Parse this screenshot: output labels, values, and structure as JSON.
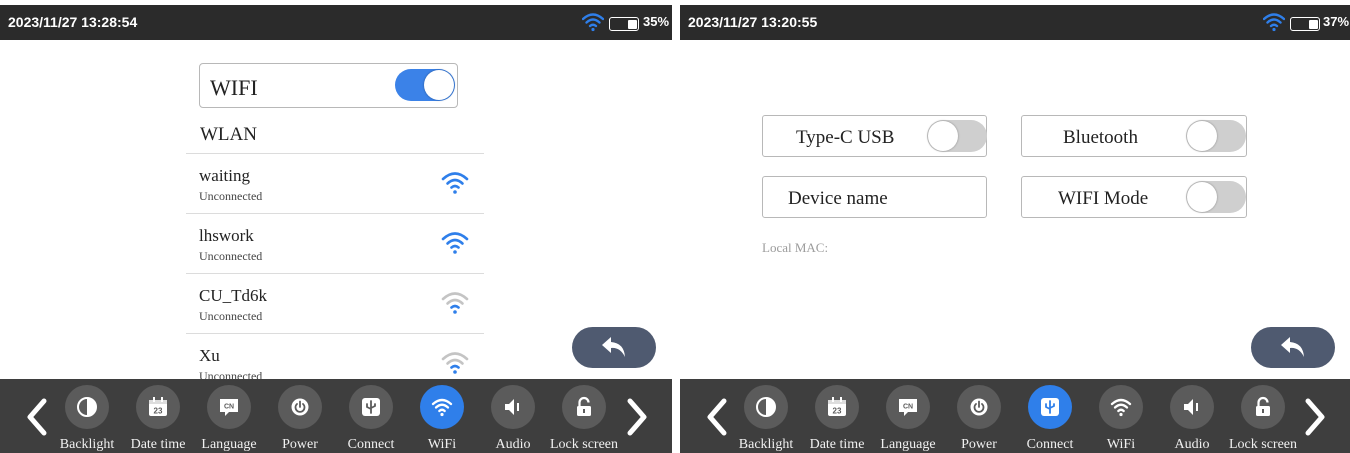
{
  "left": {
    "statusbar": {
      "datetime": "2023/11/27 13:28:54",
      "battery": "35%",
      "battery_level": 0.35
    },
    "wifi_toggle": {
      "label": "WIFI",
      "on": true
    },
    "wlan_header": "WLAN",
    "networks": [
      {
        "ssid": "waiting",
        "status": "Unconnected",
        "signal": "strong"
      },
      {
        "ssid": "lhswork",
        "status": "Unconnected",
        "signal": "strong"
      },
      {
        "ssid": "CU_Td6k",
        "status": "Unconnected",
        "signal": "weak"
      },
      {
        "ssid": "Xu",
        "status": "Unconnected",
        "signal": "weak"
      }
    ],
    "active_tab": "WiFi"
  },
  "right": {
    "statusbar": {
      "datetime": "2023/11/27 13:20:55",
      "battery": "37%",
      "battery_level": 0.37
    },
    "options": {
      "typec": {
        "label": "Type-C USB",
        "on": false
      },
      "bluetooth": {
        "label": "Bluetooth",
        "on": false
      },
      "device_name": {
        "label": "Device name"
      },
      "wifi_mode": {
        "label": "WIFI Mode",
        "on": false
      }
    },
    "local_mac": "Local MAC:",
    "active_tab": "Connect"
  },
  "nav": {
    "items": [
      {
        "label": "Backlight",
        "icon": "contrast-icon"
      },
      {
        "label": "Date time",
        "icon": "calendar-icon"
      },
      {
        "label": "Language",
        "icon": "language-icon"
      },
      {
        "label": "Power",
        "icon": "power-icon"
      },
      {
        "label": "Connect",
        "icon": "usb-icon"
      },
      {
        "label": "WiFi",
        "icon": "wifi-icon"
      },
      {
        "label": "Audio",
        "icon": "speaker-icon"
      },
      {
        "label": "Lock screen",
        "icon": "lock-icon"
      }
    ],
    "calendar_day": "23",
    "language_code": "CN"
  },
  "colors": {
    "accent": "#2f7fea",
    "statusbar": "#2b2b2b",
    "navbar": "#3e3e3e",
    "back_button": "#4f5a70"
  }
}
